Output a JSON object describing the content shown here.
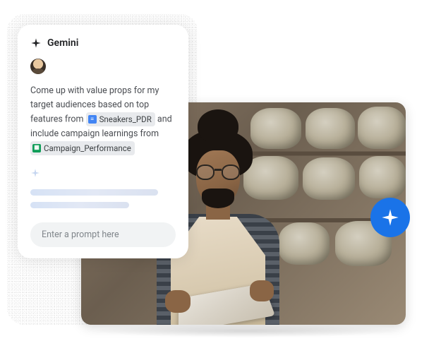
{
  "panel": {
    "title": "Gemini",
    "prompt": {
      "line1": "Come up with value props for my target audiences based on top features from ",
      "chip1_label": "Sneakers_PDR",
      "chip1_icon": "docs",
      "line2": " and include campaign learnings from ",
      "chip2_label": "Campaign_Performance",
      "chip2_icon": "sheets"
    },
    "input_placeholder": "Enter a prompt here"
  },
  "colors": {
    "badge_bg": "#1a73e8",
    "docs_icon": "#4285f4",
    "sheets_icon": "#0f9d58"
  },
  "photo": {
    "description": "Person with curly hair bun and glasses wearing apron, looking at tablet in storage room with bagged goods on shelves"
  }
}
